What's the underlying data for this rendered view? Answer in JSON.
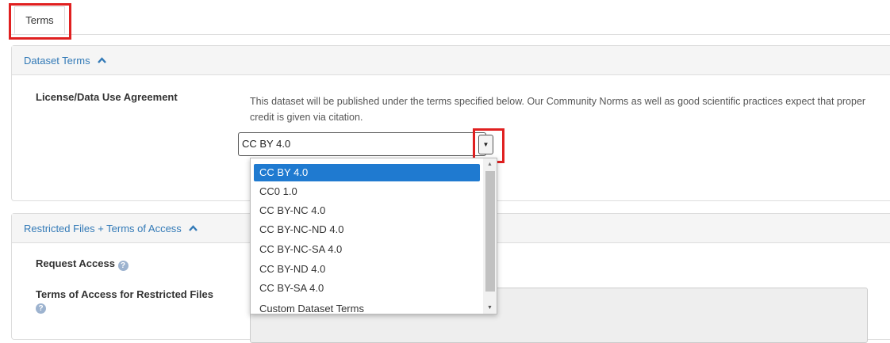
{
  "tabs": [
    {
      "label": "Terms",
      "active": true
    }
  ],
  "dataset_terms": {
    "header": "Dataset Terms",
    "license_label": "License/Data Use Agreement",
    "description": "This dataset will be published under the terms specified below. Our Community Norms as well as good scientific practices expect that proper credit is given via citation.",
    "license_select": {
      "selected": "CC BY 4.0",
      "options": [
        "CC BY 4.0",
        "CC0 1.0",
        "CC BY-NC 4.0",
        "CC BY-NC-ND 4.0",
        "CC BY-NC-SA 4.0",
        "CC BY-ND 4.0",
        "CC BY-SA 4.0",
        "Custom Dataset Terms"
      ]
    }
  },
  "restricted": {
    "header": "Restricted Files + Terms of Access",
    "request_access_label": "Request Access",
    "terms_label": "Terms of Access for Restricted Files"
  },
  "icons": {
    "caret_up": "▲",
    "caret_down": "▼",
    "help": "?"
  },
  "colors": {
    "link": "#337ab7",
    "highlight": "#e02020",
    "selected_option": "#1f7ad0"
  }
}
